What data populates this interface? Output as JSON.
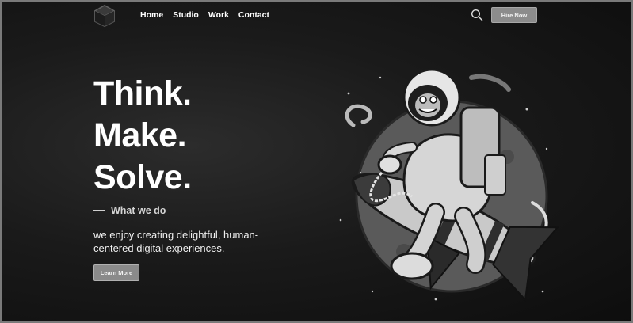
{
  "nav": {
    "items": [
      "Home",
      "Studio",
      "Work",
      "Contact"
    ]
  },
  "header": {
    "hire_label": "Hire Now",
    "search_icon": "search-icon",
    "logo_icon": "cube-logo-icon"
  },
  "hero": {
    "title_lines": [
      "Think.",
      "Make.",
      "Solve."
    ],
    "kicker": "What we do",
    "description": "we enjoy creating delightful, human-centered digital experiences.",
    "cta_label": "Learn More"
  },
  "illustration": {
    "icon": "astronaut-riding-rocket-illustration"
  }
}
